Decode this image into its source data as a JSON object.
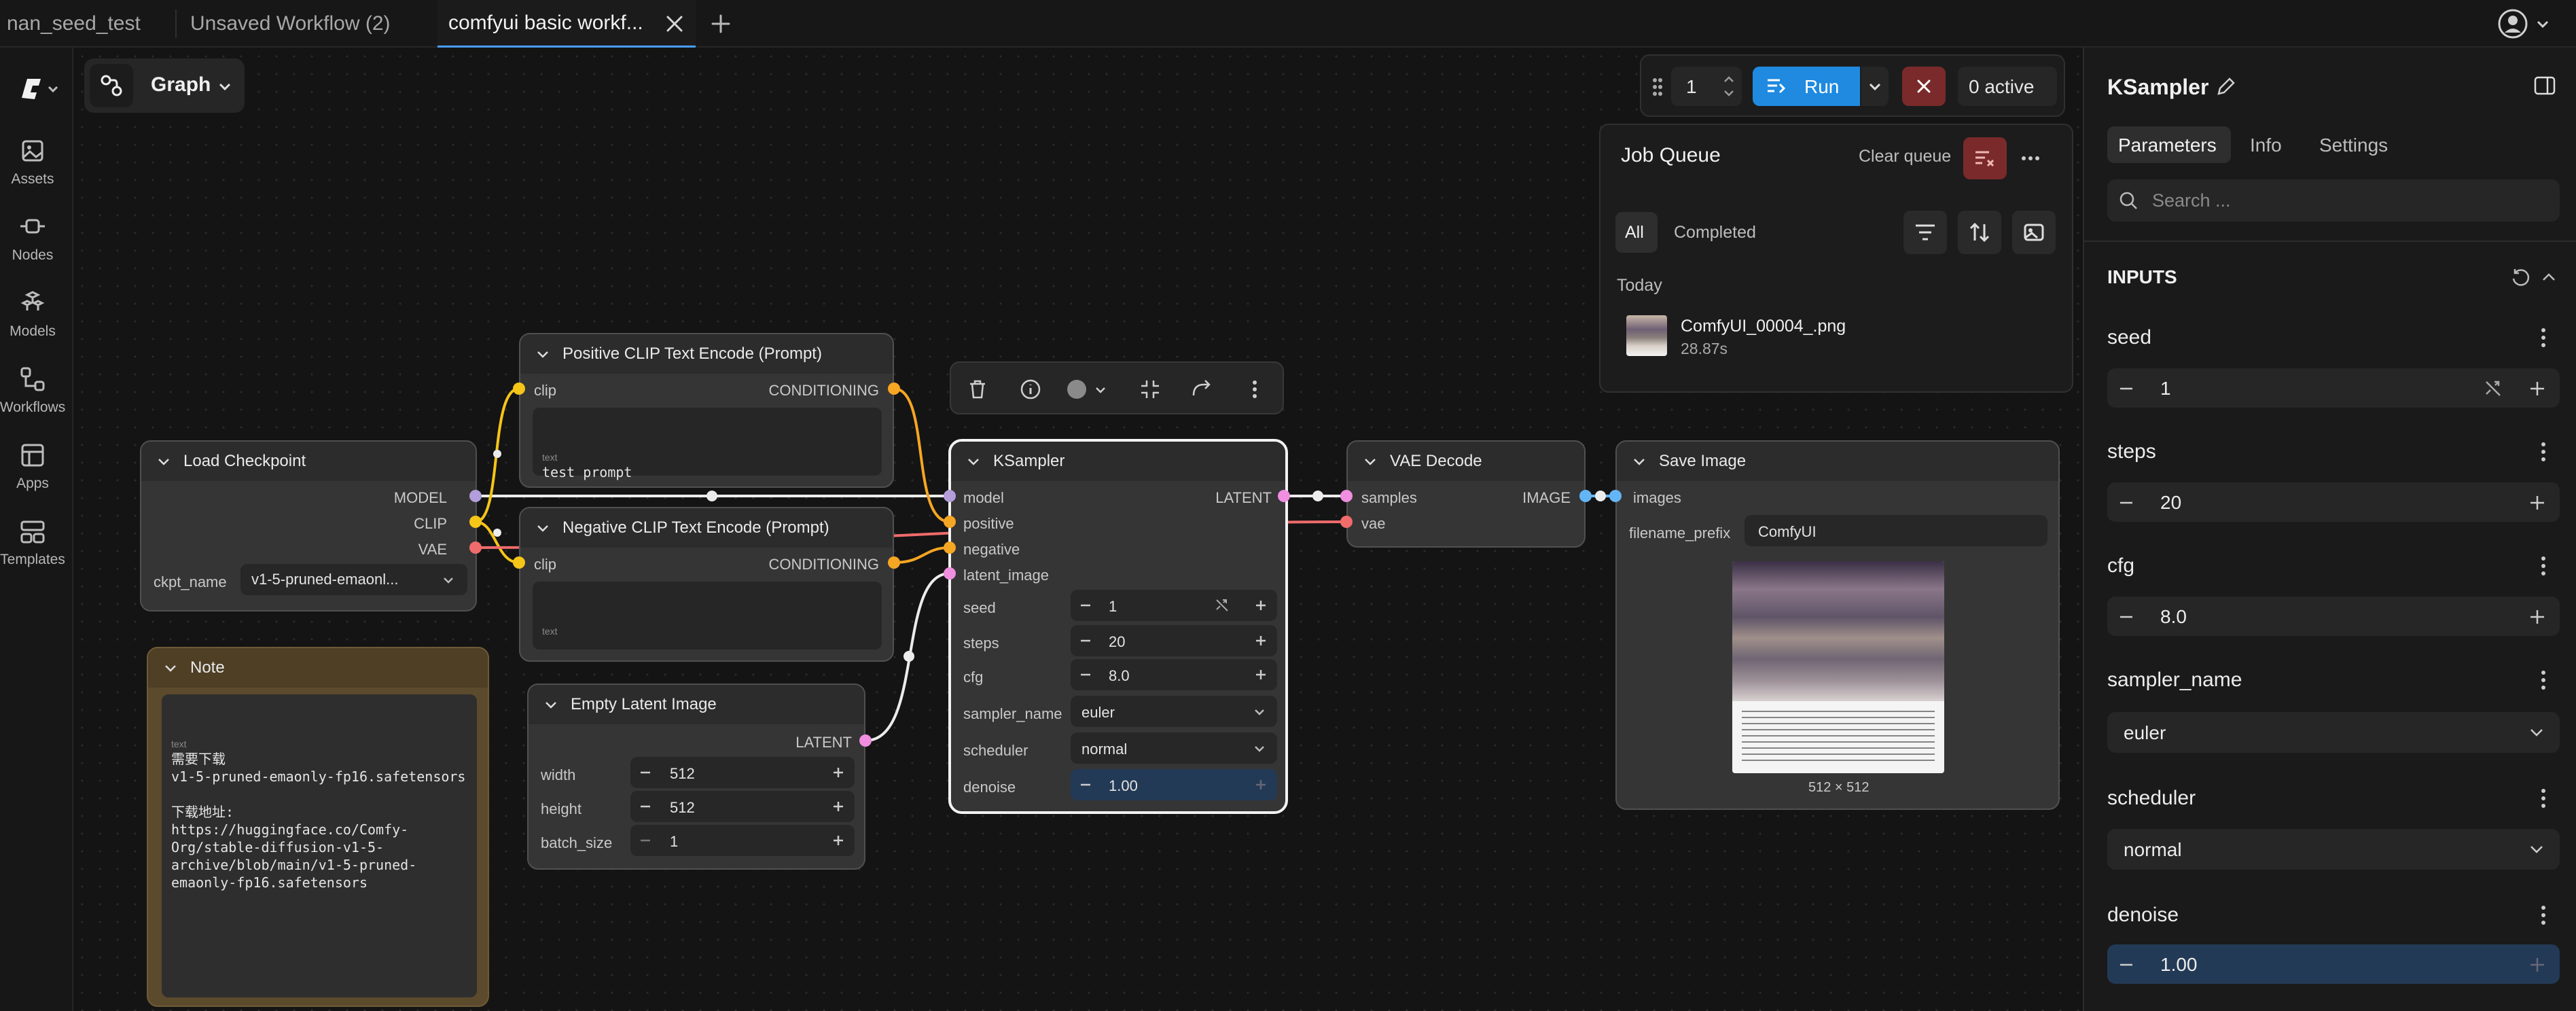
{
  "tabs": [
    {
      "label": "nan_seed_test"
    },
    {
      "label": "Unsaved Workflow (2)"
    },
    {
      "label": "comfyui basic workf..."
    }
  ],
  "sidebar": {
    "items": [
      {
        "label": "Assets",
        "icon": "image-icon"
      },
      {
        "label": "Nodes",
        "icon": "node-icon"
      },
      {
        "label": "Models",
        "icon": "cube-icon"
      },
      {
        "label": "Workflows",
        "icon": "workflow-icon"
      },
      {
        "label": "Apps",
        "icon": "app-icon"
      },
      {
        "label": "Templates",
        "icon": "template-icon"
      }
    ]
  },
  "graph_mode": {
    "label": "Graph"
  },
  "run_bar": {
    "count": "1",
    "run_label": "Run",
    "active_label": "0 active"
  },
  "job_queue": {
    "title": "Job Queue",
    "clear_label": "Clear queue",
    "filters": [
      "All",
      "Completed"
    ],
    "group_label": "Today",
    "jobs": [
      {
        "name": "ComfyUI_00004_.png",
        "duration": "28.87s"
      }
    ]
  },
  "nodes": {
    "load_checkpoint": {
      "title": "Load Checkpoint",
      "outputs": [
        "MODEL",
        "CLIP",
        "VAE"
      ],
      "ckpt_label": "ckpt_name",
      "ckpt_value": "v1-5-pruned-emaonl..."
    },
    "positive_clip": {
      "title": "Positive CLIP Text Encode (Prompt)",
      "input": "clip",
      "output": "CONDITIONING",
      "text_label": "text",
      "text_value": "test prompt"
    },
    "negative_clip": {
      "title": "Negative CLIP Text Encode (Prompt)",
      "input": "clip",
      "output": "CONDITIONING",
      "text_label": "text",
      "text_value": ""
    },
    "empty_latent": {
      "title": "Empty Latent Image",
      "output": "LATENT",
      "width_label": "width",
      "width_value": "512",
      "height_label": "height",
      "height_value": "512",
      "batch_label": "batch_size",
      "batch_value": "1"
    },
    "note": {
      "title": "Note",
      "text_label": "text",
      "text_value": "需要下载\nv1-5-pruned-emaonly-fp16.safetensors\n\n下载地址:\nhttps://huggingface.co/Comfy-\nOrg/stable-diffusion-v1-5-\narchive/blob/main/v1-5-pruned-\nemaonly-fp16.safetensors"
    },
    "ksampler": {
      "title": "KSampler",
      "inputs": [
        "model",
        "positive",
        "negative",
        "latent_image"
      ],
      "output": "LATENT",
      "seed_label": "seed",
      "seed_value": "1",
      "steps_label": "steps",
      "steps_value": "20",
      "cfg_label": "cfg",
      "cfg_value": "8.0",
      "sampler_label": "sampler_name",
      "sampler_value": "euler",
      "scheduler_label": "scheduler",
      "scheduler_value": "normal",
      "denoise_label": "denoise",
      "denoise_value": "1.00"
    },
    "vae_decode": {
      "title": "VAE Decode",
      "inputs": [
        "samples",
        "vae"
      ],
      "output": "IMAGE"
    },
    "save_image": {
      "title": "Save Image",
      "input": "images",
      "prefix_label": "filename_prefix",
      "prefix_value": "ComfyUI",
      "image_size": "512 × 512"
    }
  },
  "right_panel": {
    "title": "KSampler",
    "tabs": [
      "Parameters",
      "Info",
      "Settings"
    ],
    "search_placeholder": "Search ...",
    "section": "INPUTS",
    "fields": {
      "seed_label": "seed",
      "seed_value": "1",
      "steps_label": "steps",
      "steps_value": "20",
      "cfg_label": "cfg",
      "cfg_value": "8.0",
      "sampler_label": "sampler_name",
      "sampler_value": "euler",
      "scheduler_label": "scheduler",
      "scheduler_value": "normal",
      "denoise_label": "denoise",
      "denoise_value": "1.00"
    }
  },
  "colors": {
    "accent": "#1f8ae0",
    "model_slot": "#b39ddb",
    "clip_slot": "#f5c518",
    "vae_slot": "#f06b6b",
    "conditioning_slot": "#f5a623",
    "latent_slot": "#f08ee0",
    "image_slot": "#64b5f6"
  }
}
